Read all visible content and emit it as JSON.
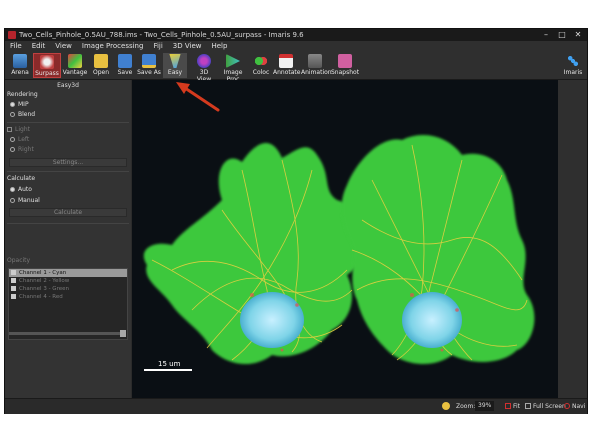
{
  "window": {
    "title": "Two_Cells_Pinhole_0.5AU_788.ims - Two_Cells_Pinhole_0.5AU_surpass - Imaris 9.6",
    "controls": [
      "–",
      "□",
      "✕"
    ]
  },
  "menu": [
    "File",
    "Edit",
    "View",
    "Image Processing",
    "Fiji",
    "3D View",
    "Help"
  ],
  "toolbar": {
    "buttons": [
      {
        "label": "Arena",
        "icon": "arena-icon"
      },
      {
        "label": "Surpass",
        "icon": "surpass-icon"
      },
      {
        "label": "Vantage",
        "icon": "vantage-icon"
      },
      {
        "label": "Open",
        "icon": "folder-icon"
      },
      {
        "label": "Save",
        "icon": "save-icon"
      },
      {
        "label": "Save As",
        "icon": "save-as-icon"
      },
      {
        "label": "Easy",
        "icon": "easy3d-icon"
      },
      {
        "label": "3D View",
        "icon": "3d-view-icon"
      },
      {
        "label": "Image Proc",
        "icon": "image-proc-icon"
      },
      {
        "label": "Coloc",
        "icon": "coloc-icon"
      },
      {
        "label": "Annotate",
        "icon": "annotate-icon"
      },
      {
        "label": "Animation",
        "icon": "animation-icon"
      },
      {
        "label": "Snapshot",
        "icon": "snapshot-icon"
      }
    ],
    "imaris_label": "Imaris"
  },
  "sidebar": {
    "title": "Easy3d",
    "rendering_label": "Rendering",
    "mip_label": "MIP",
    "blend_label": "Blend",
    "light_label": "Light",
    "left_label": "Left",
    "right_label": "Right",
    "settings_label": "Settings...",
    "calculate_label": "Calculate",
    "auto_label": "Auto",
    "manual_label": "Manual",
    "calculate_button": "Calculate",
    "opacity_label": "Opacity",
    "channels": [
      {
        "label": "Channel 1 - Cyan"
      },
      {
        "label": "Channel 2 - Yellow"
      },
      {
        "label": "Channel 3 - Green"
      },
      {
        "label": "Channel 4 - Red"
      }
    ]
  },
  "view": {
    "scalebar": "15 um"
  },
  "status": {
    "zoom_label": "Zoom:",
    "zoom_value": "39%",
    "fit_label": "Fit",
    "fullscreen_label": "Full Screen",
    "navi_label": "Navi"
  },
  "colors": {
    "accent": "#c0392b",
    "arrow": "#d43a1e",
    "selected_button": "#8a2a2a",
    "cell_green": "#3cc83c",
    "cell_yellow": "#e8d040",
    "nucleus_cyan": "#7fd4e8"
  }
}
